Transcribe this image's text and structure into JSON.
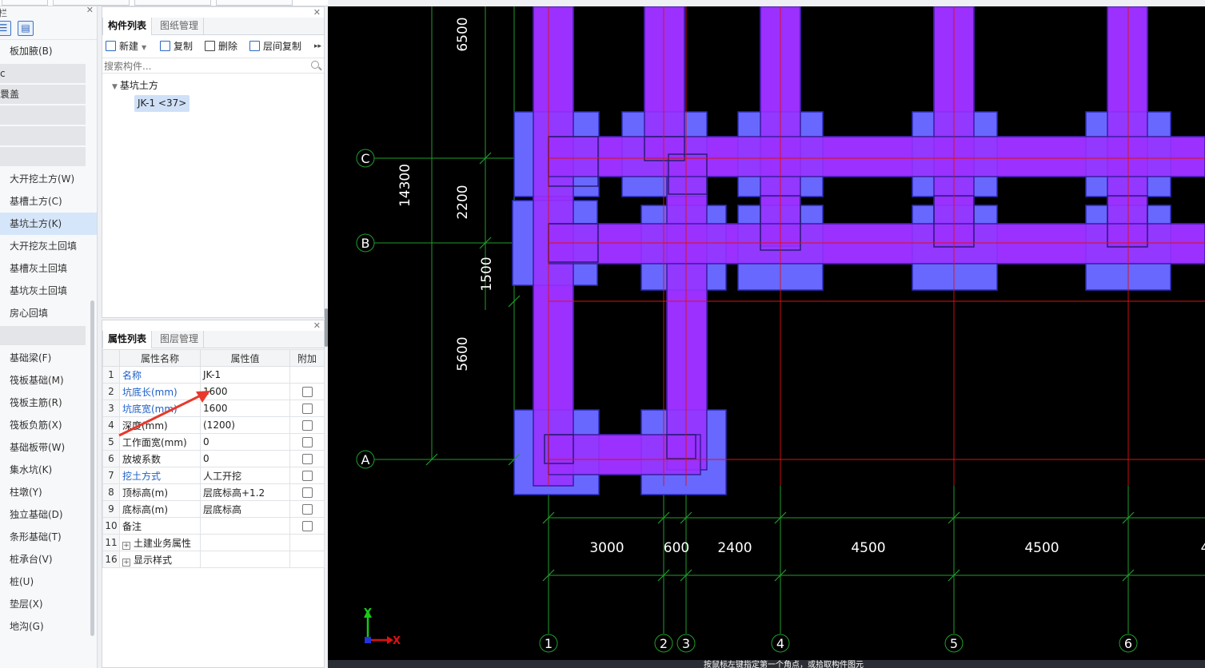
{
  "left_nav": {
    "panel_title": "栏",
    "items": [
      {
        "label": "板加腋(B)",
        "kind": "item"
      },
      {
        "label": "c",
        "kind": "group"
      },
      {
        "label": "睘盖",
        "kind": "group"
      },
      {
        "label": "",
        "kind": "group"
      },
      {
        "label": "",
        "kind": "group"
      },
      {
        "label": "",
        "kind": "group"
      },
      {
        "label": "大开挖土方(W)",
        "kind": "item"
      },
      {
        "label": "基槽土方(C)",
        "kind": "item"
      },
      {
        "label": "基坑土方(K)",
        "kind": "item",
        "active": true
      },
      {
        "label": "大开挖灰土回填",
        "kind": "item"
      },
      {
        "label": "基槽灰土回填",
        "kind": "item"
      },
      {
        "label": "基坑灰土回填",
        "kind": "item"
      },
      {
        "label": "房心回填",
        "kind": "item"
      },
      {
        "label": "",
        "kind": "group"
      },
      {
        "label": "基础梁(F)",
        "kind": "item"
      },
      {
        "label": "筏板基础(M)",
        "kind": "item"
      },
      {
        "label": "筏板主筋(R)",
        "kind": "item"
      },
      {
        "label": "筏板负筋(X)",
        "kind": "item"
      },
      {
        "label": "基础板带(W)",
        "kind": "item"
      },
      {
        "label": "集水坑(K)",
        "kind": "item"
      },
      {
        "label": "柱墩(Y)",
        "kind": "item"
      },
      {
        "label": "独立基础(D)",
        "kind": "item"
      },
      {
        "label": "条形基础(T)",
        "kind": "item"
      },
      {
        "label": "桩承台(V)",
        "kind": "item"
      },
      {
        "label": "桩(U)",
        "kind": "item"
      },
      {
        "label": "垫层(X)",
        "kind": "item"
      },
      {
        "label": "地沟(G)",
        "kind": "item"
      }
    ]
  },
  "component_panel": {
    "tabs": [
      "构件列表",
      "图纸管理"
    ],
    "toolbar": {
      "new": "新建",
      "copy": "复制",
      "delete": "删除",
      "floor_copy": "层间复制"
    },
    "search_placeholder": "搜索构件...",
    "tree_root": "基坑土方",
    "tree_node": "JK-1 <37>"
  },
  "property_panel": {
    "tabs": [
      "属性列表",
      "图层管理"
    ],
    "columns": [
      "属性名称",
      "属性值",
      "附加"
    ],
    "rows": [
      {
        "num": "1",
        "name": "名称",
        "value": "JK-1",
        "blue": true,
        "check": false
      },
      {
        "num": "2",
        "name": "坑底长(mm)",
        "value": "1600",
        "blue": true,
        "check": true
      },
      {
        "num": "3",
        "name": "坑底宽(mm)",
        "value": "1600",
        "blue": true,
        "check": true
      },
      {
        "num": "4",
        "name": "深度(mm)",
        "value": "(1200)",
        "blue": false,
        "check": true
      },
      {
        "num": "5",
        "name": "工作面宽(mm)",
        "value": "0",
        "blue": false,
        "check": true
      },
      {
        "num": "6",
        "name": "放坡系数",
        "value": "0",
        "blue": false,
        "check": true
      },
      {
        "num": "7",
        "name": "挖土方式",
        "value": "人工开挖",
        "blue": true,
        "check": true
      },
      {
        "num": "8",
        "name": "顶标高(m)",
        "value": "层底标高+1.2",
        "blue": false,
        "check": true
      },
      {
        "num": "9",
        "name": "底标高(m)",
        "value": "层底标高",
        "blue": false,
        "check": true
      },
      {
        "num": "10",
        "name": "备注",
        "value": "",
        "blue": false,
        "check": true
      },
      {
        "num": "11",
        "name": "土建业务属性",
        "value": "",
        "blue": false,
        "check": false,
        "expander": true
      },
      {
        "num": "16",
        "name": "显示样式",
        "value": "",
        "blue": false,
        "check": false,
        "expander": true
      }
    ]
  },
  "canvas": {
    "axis_labels_y": [
      "C",
      "B",
      "A"
    ],
    "axis_labels_x": [
      "1",
      "2",
      "3",
      "4",
      "5",
      "6"
    ],
    "dims_vertical": [
      "6500",
      "14300",
      "2200",
      "1500",
      "5600"
    ],
    "dims_horizontal": [
      "3000",
      "600",
      "2400",
      "4500",
      "4500",
      "4"
    ],
    "ucs_x": "X",
    "ucs_y": "Y",
    "colors": {
      "beam": "#9b30ff",
      "pit": "#6868ff",
      "grid": "#1f9e2a",
      "red_line": "#e01010"
    }
  },
  "status_text": "按鼠标左键指定第一个角点，或拾取构件图元"
}
